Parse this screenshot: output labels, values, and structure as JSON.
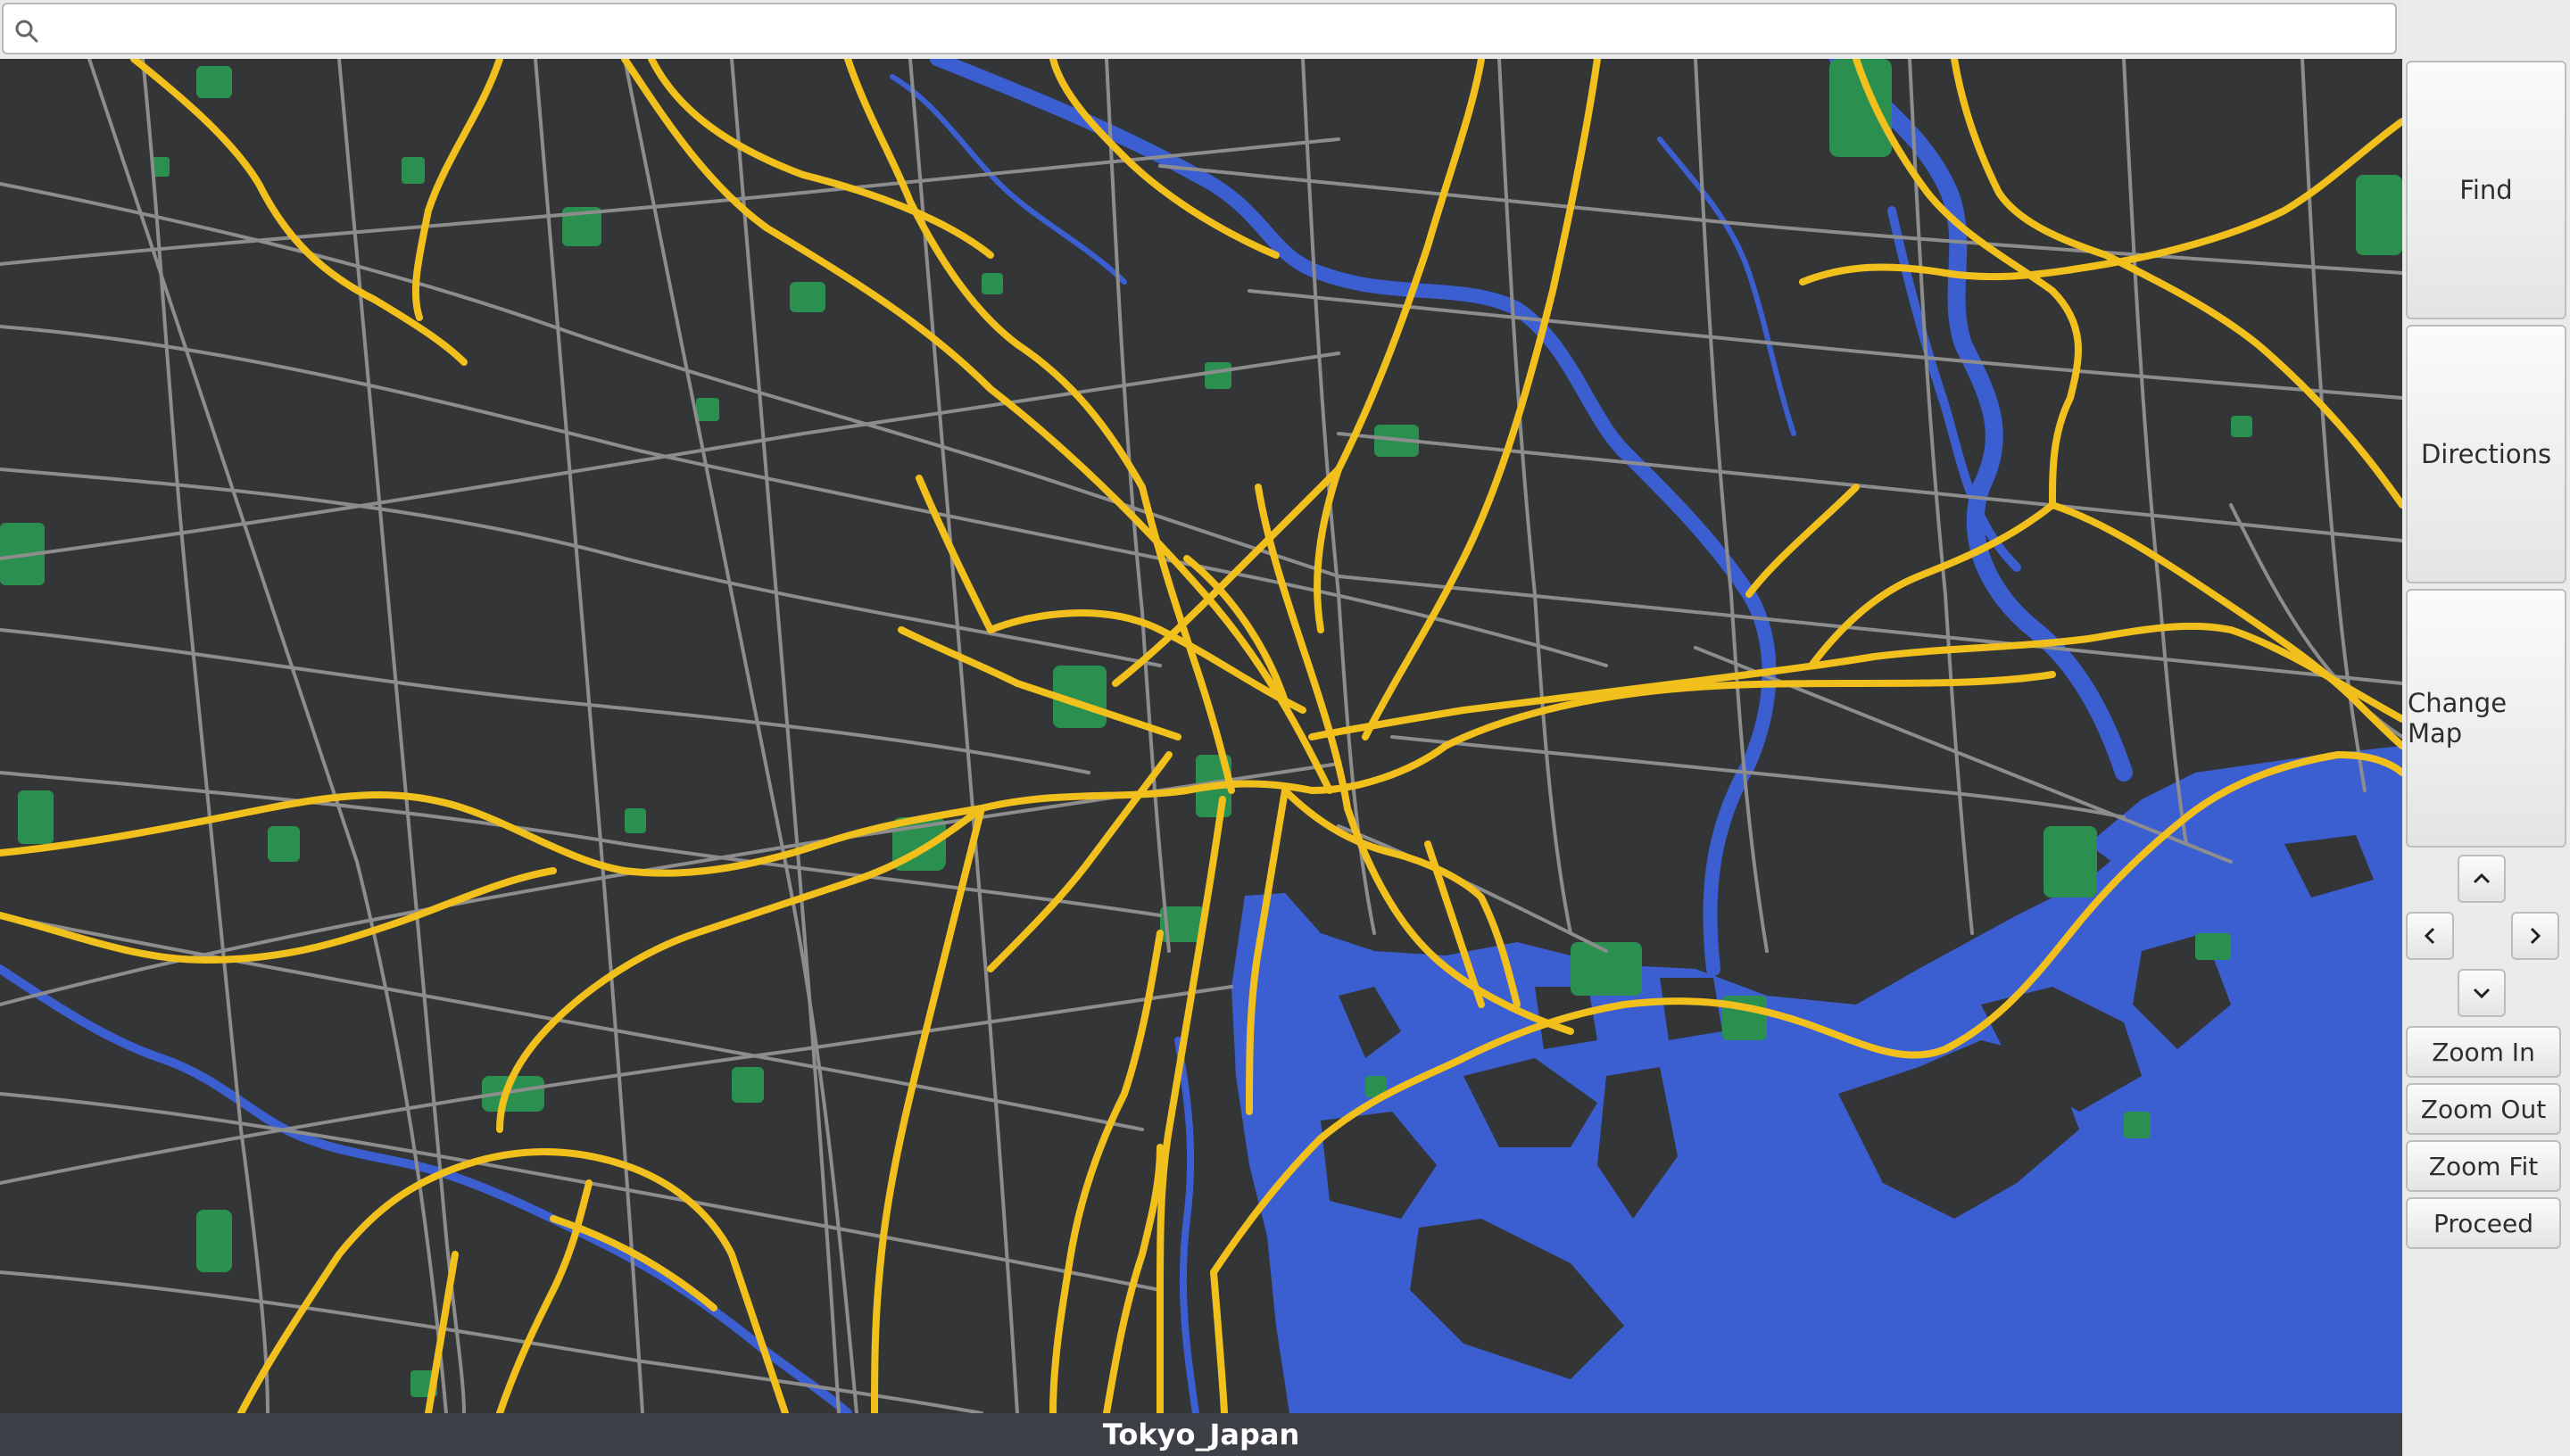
{
  "search": {
    "placeholder": "",
    "value": ""
  },
  "map": {
    "title": "Tokyo_Japan",
    "colors": {
      "land": "#333536",
      "water": "#3b5fd1",
      "park": "#2a8f4f",
      "minor_road": "#8d8d8d",
      "highway": "#f2c01d"
    }
  },
  "panel": {
    "find_label": "Find",
    "directions_label": "Directions",
    "change_map_label": "Change Map",
    "zoom_in_label": "Zoom In",
    "zoom_out_label": "Zoom Out",
    "zoom_fit_label": "Zoom Fit",
    "proceed_label": "Proceed"
  },
  "icons": {
    "search": "search-icon",
    "pan_up": "chevron-up-icon",
    "pan_left": "chevron-left-icon",
    "pan_right": "chevron-right-icon",
    "pan_down": "chevron-down-icon"
  }
}
